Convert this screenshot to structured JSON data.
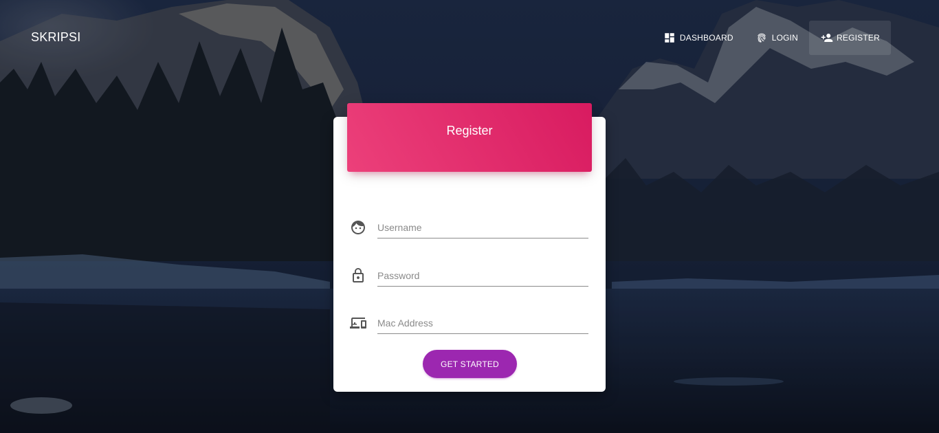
{
  "brand": "SKRIPSI",
  "nav": {
    "dashboard": "DASHBOARD",
    "login": "LOGIN",
    "register": "REGISTER"
  },
  "card": {
    "title": "Register",
    "fields": {
      "username_placeholder": "Username",
      "password_placeholder": "Password",
      "mac_placeholder": "Mac Address"
    },
    "button": "GET STARTED"
  },
  "colors": {
    "header_gradient_start": "#ec407a",
    "header_gradient_end": "#d81b60",
    "button": "#9c27b0"
  },
  "icons": {
    "dashboard": "dashboard-icon",
    "login": "fingerprint-icon",
    "register": "person-add-icon",
    "username": "face-icon",
    "password": "lock-icon",
    "mac": "devices-icon"
  }
}
